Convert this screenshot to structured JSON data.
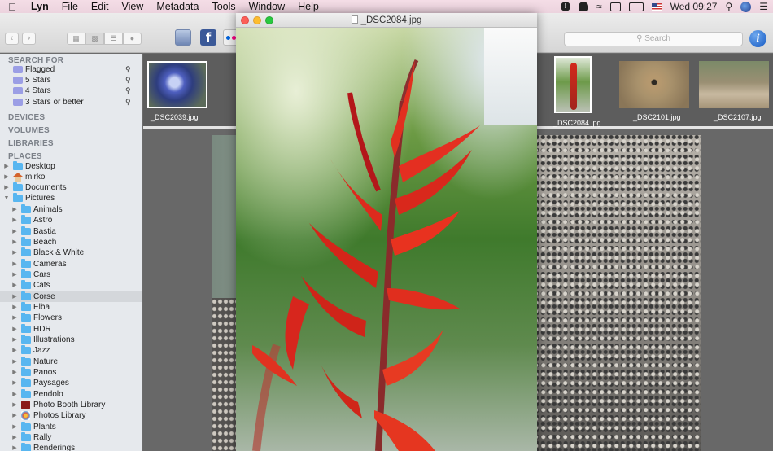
{
  "menubar": {
    "apple": "",
    "app": "Lyn",
    "items": [
      "File",
      "Edit",
      "View",
      "Metadata",
      "Tools",
      "Window",
      "Help"
    ],
    "clock": "Wed 09:27"
  },
  "toolbar": {
    "search_placeholder": "Search",
    "facebook_glyph": "f",
    "info_glyph": "i"
  },
  "sidebar": {
    "search_for_title": "SEARCH FOR",
    "smart": [
      {
        "label": "Flagged"
      },
      {
        "label": "5 Stars"
      },
      {
        "label": "4 Stars"
      },
      {
        "label": "3 Stars or better"
      }
    ],
    "devices_title": "DEVICES",
    "volumes_title": "VOLUMES",
    "libraries_title": "LIBRARIES",
    "places_title": "PLACES",
    "places": [
      {
        "label": "Desktop"
      },
      {
        "label": "mirko"
      },
      {
        "label": "Documents"
      },
      {
        "label": "Pictures"
      }
    ],
    "folders": [
      {
        "label": "Animals"
      },
      {
        "label": "Astro"
      },
      {
        "label": "Bastia"
      },
      {
        "label": "Beach"
      },
      {
        "label": "Black & White"
      },
      {
        "label": "Cameras"
      },
      {
        "label": "Cars"
      },
      {
        "label": "Cats"
      },
      {
        "label": "Corse"
      },
      {
        "label": "Elba"
      },
      {
        "label": "Flowers"
      },
      {
        "label": "HDR"
      },
      {
        "label": "Illustrations"
      },
      {
        "label": "Jazz"
      },
      {
        "label": "Nature"
      },
      {
        "label": "Panos"
      },
      {
        "label": "Paysages"
      },
      {
        "label": "Pendolo"
      },
      {
        "label": "Photo Booth Library"
      },
      {
        "label": "Photos Library"
      },
      {
        "label": "Plants"
      },
      {
        "label": "Rally"
      },
      {
        "label": "Renderings"
      }
    ]
  },
  "strip": {
    "thumbs": [
      {
        "label": "_DSC2039.jpg"
      },
      {
        "label": "_DSC2084.jpg"
      },
      {
        "label": "_DSC2101.jpg"
      },
      {
        "label": "_DSC2107.jpg"
      }
    ]
  },
  "quicklook": {
    "title": "_DSC2084.jpg"
  }
}
